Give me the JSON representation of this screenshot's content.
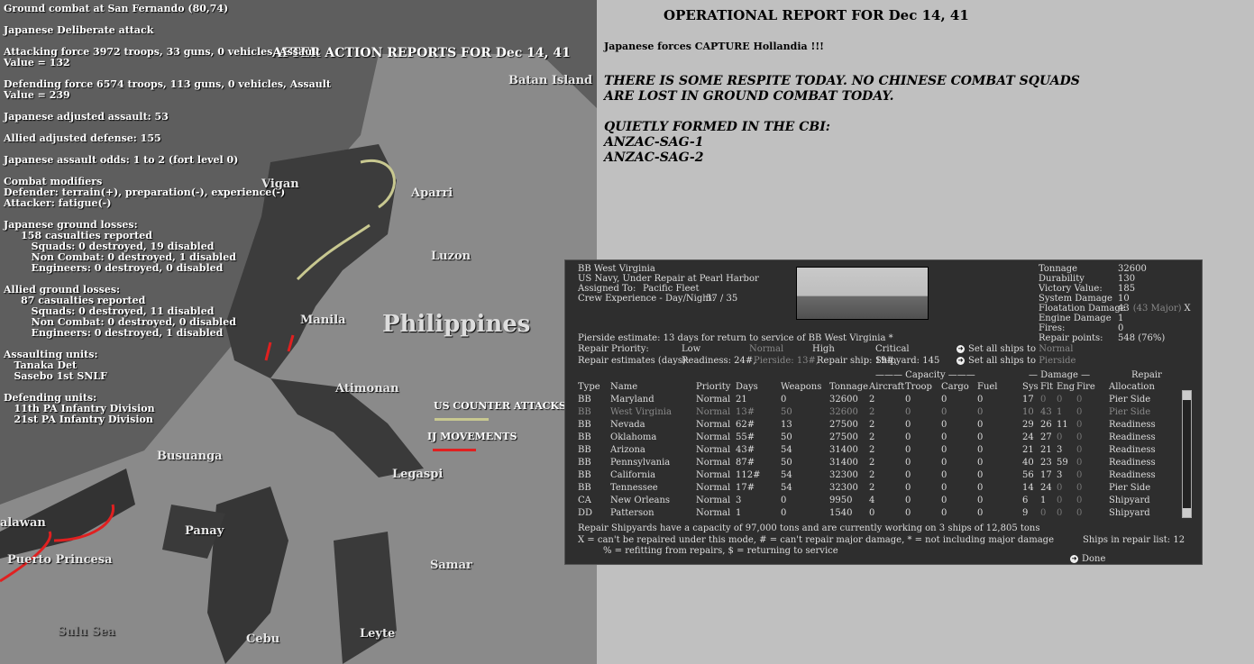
{
  "aar": {
    "title": "AFTER ACTION REPORTS FOR Dec 14, 41",
    "lines": [
      "Ground combat at San Fernando (80,74)",
      "",
      "Japanese Deliberate attack",
      "",
      "Attacking force 3972 troops, 33 guns, 0 vehicles, Assault",
      "Value = 132",
      "",
      "Defending force 6574 troops, 113 guns, 0 vehicles, Assault",
      "Value = 239",
      "",
      "Japanese adjusted assault: 53",
      "",
      "Allied adjusted defense: 155",
      "",
      "Japanese assault odds: 1 to 2 (fort level 0)",
      "",
      "Combat modifiers",
      "Defender: terrain(+), preparation(-), experience(-)",
      "Attacker: fatigue(-)",
      "",
      "Japanese ground losses:",
      "     158 casualties reported",
      "        Squads: 0 destroyed, 19 disabled",
      "        Non Combat: 0 destroyed, 1 disabled",
      "        Engineers: 0 destroyed, 0 disabled",
      "",
      "Allied ground losses:",
      "     87 casualties reported",
      "        Squads: 0 destroyed, 11 disabled",
      "        Non Combat: 0 destroyed, 0 disabled",
      "        Engineers: 0 destroyed, 1 disabled",
      "",
      "Assaulting units:",
      "   Tanaka Det",
      "   Sasebo 1st SNLF",
      "",
      "Defending units:",
      "   11th PA Infantry Division",
      "   21st PA Infantry Division"
    ]
  },
  "map": {
    "labels": [
      "Batan Island",
      "Vigan",
      "Aparri",
      "Luzon",
      "Manila",
      "Philippines",
      "Atimonan",
      "Busuanga",
      "Legaspi",
      "Panay",
      "Samar",
      "Puerto Princesa",
      "alawan",
      "Sulu Sea",
      "Cebu",
      "Leyte"
    ],
    "legend": {
      "counter": "US COUNTER ATTACKS",
      "ij": "IJ MOVEMENTS"
    },
    "colors": {
      "counter": "#c8c890",
      "ij": "#e02020"
    }
  },
  "op": {
    "title": "OPERATIONAL REPORT FOR Dec 14, 41",
    "capture": "Japanese forces CAPTURE Hollandia !!!",
    "lines": [
      "THERE IS SOME RESPITE TODAY. NO CHINESE COMBAT SQUADS",
      "ARE LOST IN GROUND COMBAT TODAY.",
      "",
      "QUIETLY FORMED IN THE CBI:",
      "ANZAC-SAG-1",
      "ANZAC-SAG-2"
    ]
  },
  "dlg": {
    "name": "BB West Virginia",
    "status": "US Navy, Under Repair at Pearl Harbor",
    "assigned_label": "Assigned To:",
    "assigned": "Pacific Fleet",
    "crew_label": "Crew Experience - Day/Night:",
    "crew": "57 / 35",
    "stats": [
      [
        "Tonnage",
        "32600"
      ],
      [
        "Durability",
        "130"
      ],
      [
        "Victory Value:",
        "185"
      ],
      [
        "System Damage",
        "10"
      ],
      [
        "Floatation Damage",
        "43"
      ],
      [
        "Engine Damage",
        "1"
      ],
      [
        "Fires:",
        "0"
      ],
      [
        "Repair points:",
        "548 (76%)"
      ]
    ],
    "flt_major": "(43 Major)",
    "flt_x": "X",
    "pierside": "Pierside estimate: 13 days for return to service of BB West Virginia  *",
    "priority_label": "Repair Priority:",
    "priorities": [
      "Low",
      "Normal",
      "High",
      "Critical"
    ],
    "est_label": "Repair estimates (days):",
    "estimates": [
      "Readiness: 24#,",
      "Pierside: 13#,",
      "Repair ship: 19#,",
      "Shipyard: 145"
    ],
    "set_normal": "Set all ships to ",
    "set_normal_v": "Normal",
    "set_pier": "Set all ships to ",
    "set_pier_v": "Pierside",
    "capacity_hdr": "——— Capacity ———",
    "damage_hdr": "— Damage —",
    "repair_hdr": "Repair",
    "columns": [
      "Type",
      "Name",
      "Priority",
      "Days",
      "Weapons",
      "Tonnage",
      "Aircraft",
      "Troop",
      "Cargo",
      "Fuel",
      "Sys",
      "Flt",
      "Eng",
      "Fire",
      "Allocation"
    ],
    "rows": [
      [
        "BB",
        "Maryland",
        "Normal",
        "21",
        "0",
        "32600",
        "2",
        "0",
        "0",
        "0",
        "17",
        "0",
        "0",
        "0",
        "Pier Side"
      ],
      [
        "BB",
        "West Virginia",
        "Normal",
        "13#",
        "50",
        "32600",
        "2",
        "0",
        "0",
        "0",
        "10",
        "43",
        "1",
        "0",
        "Pier Side"
      ],
      [
        "BB",
        "Nevada",
        "Normal",
        "62#",
        "13",
        "27500",
        "2",
        "0",
        "0",
        "0",
        "29",
        "26",
        "11",
        "0",
        "Readiness"
      ],
      [
        "BB",
        "Oklahoma",
        "Normal",
        "55#",
        "50",
        "27500",
        "2",
        "0",
        "0",
        "0",
        "24",
        "27",
        "0",
        "0",
        "Readiness"
      ],
      [
        "BB",
        "Arizona",
        "Normal",
        "43#",
        "54",
        "31400",
        "2",
        "0",
        "0",
        "0",
        "21",
        "21",
        "3",
        "0",
        "Readiness"
      ],
      [
        "BB",
        "Pennsylvania",
        "Normal",
        "87#",
        "50",
        "31400",
        "2",
        "0",
        "0",
        "0",
        "40",
        "23",
        "59",
        "0",
        "Readiness"
      ],
      [
        "BB",
        "California",
        "Normal",
        "112#",
        "54",
        "32300",
        "2",
        "0",
        "0",
        "0",
        "56",
        "17",
        "3",
        "0",
        "Readiness"
      ],
      [
        "BB",
        "Tennessee",
        "Normal",
        "17#",
        "54",
        "32300",
        "2",
        "0",
        "0",
        "0",
        "14",
        "24",
        "0",
        "0",
        "Pier Side"
      ],
      [
        "CA",
        "New Orleans",
        "Normal",
        "3",
        "0",
        "9950",
        "4",
        "0",
        "0",
        "0",
        "6",
        "1",
        "0",
        "0",
        "Shipyard"
      ],
      [
        "DD",
        "Patterson",
        "Normal",
        "1",
        "0",
        "1540",
        "0",
        "0",
        "0",
        "0",
        "9",
        "0",
        "0",
        "0",
        "Shipyard"
      ]
    ],
    "footer": [
      "Repair Shipyards have a capacity of 97,000 tons and are currently working on 3 ships of 12,805 tons",
      "X = can't be repaired under this mode, # = can't repair major damage, * = not including major damage",
      "% = refitting from repairs, $ = returning to service"
    ],
    "ships_in_list": "Ships in repair list: 12",
    "done": "Done"
  }
}
